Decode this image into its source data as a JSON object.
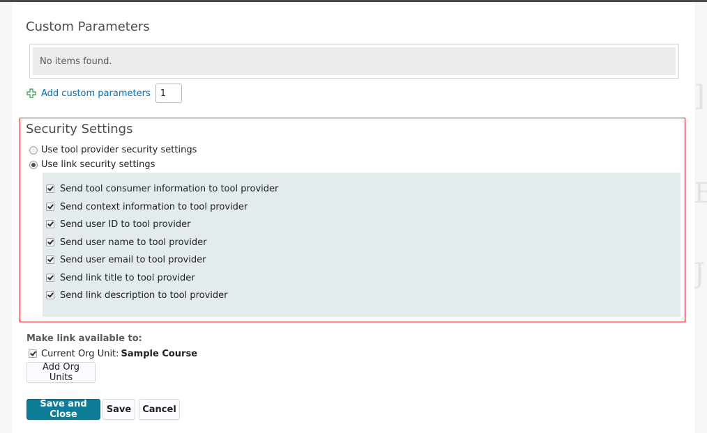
{
  "custom_parameters": {
    "heading": "Custom Parameters",
    "empty_text": "No items found.",
    "add_link_label": "Add custom parameters",
    "add_count_value": "1"
  },
  "security": {
    "heading": "Security Settings",
    "options": [
      {
        "label": "Use tool provider security settings",
        "selected": false
      },
      {
        "label": "Use link security settings",
        "selected": true
      }
    ],
    "checkboxes": [
      {
        "label": "Send tool consumer information to tool provider",
        "checked": true
      },
      {
        "label": "Send context information to tool provider",
        "checked": true
      },
      {
        "label": "Send user ID to tool provider",
        "checked": true
      },
      {
        "label": "Send user name to tool provider",
        "checked": true
      },
      {
        "label": "Send user email to tool provider",
        "checked": true
      },
      {
        "label": "Send link title to tool provider",
        "checked": true
      },
      {
        "label": "Send link description to tool provider",
        "checked": true
      }
    ]
  },
  "availability": {
    "label": "Make link available to:",
    "org_unit_prefix": "Current Org Unit:",
    "org_unit_name": "Sample Course",
    "add_org_units_label": "Add Org Units"
  },
  "actions": {
    "save_close_label": "Save and Close",
    "save_label": "Save",
    "cancel_label": "Cancel"
  },
  "colors": {
    "primary_button": "#0f7d97",
    "highlight_border": "#cd2026",
    "link": "#006fbf",
    "checkbox_area": "#e3ebed"
  }
}
